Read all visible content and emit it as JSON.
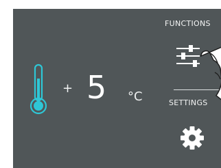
{
  "display": {
    "sign": "+",
    "temperature": "5",
    "unit": "°C"
  },
  "menu": {
    "functions_label": "FUNCTIONS",
    "settings_label": "SETTINGS"
  },
  "icons": {
    "thermometer": "thermometer-icon",
    "functions": "sliders-icon",
    "settings": "gear-icon",
    "hand": "pointing-hand-icon"
  },
  "colors": {
    "panel": "#505658",
    "accent": "#2ec7d6",
    "text": "#ffffff"
  }
}
